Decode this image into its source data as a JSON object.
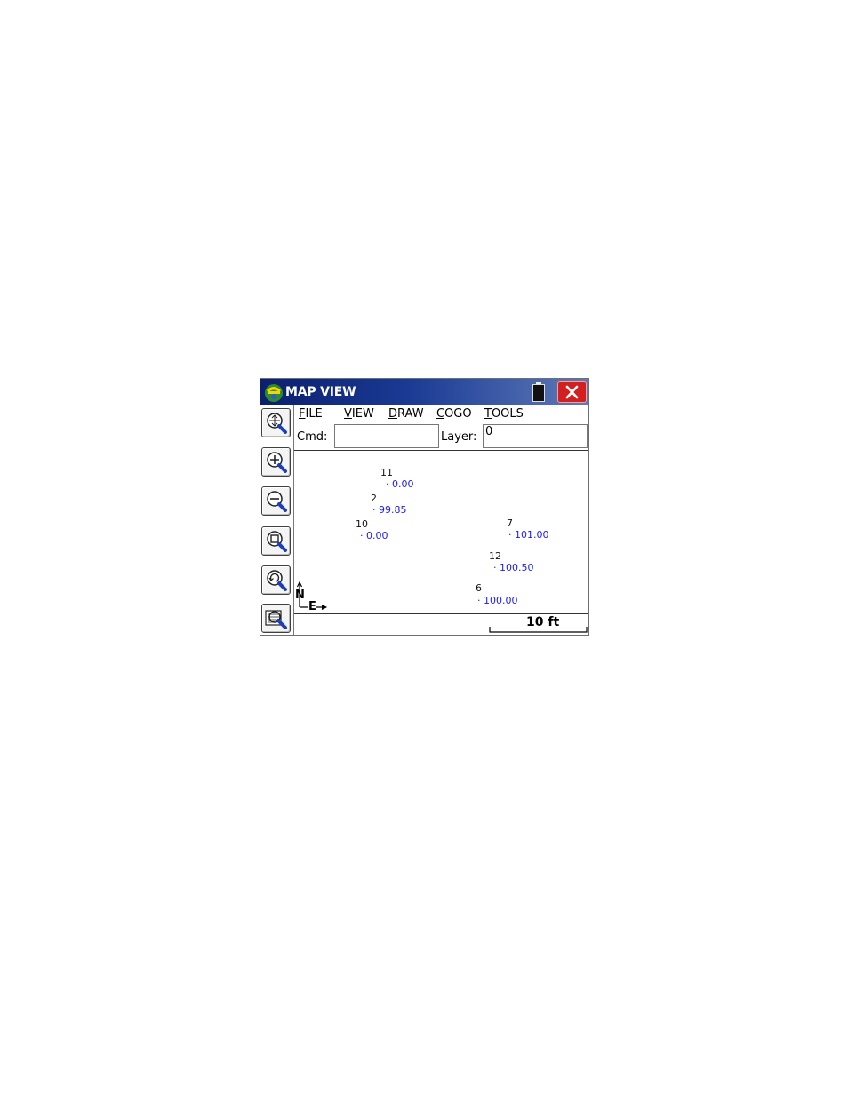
{
  "window": {
    "title": "MAP VIEW",
    "icons": {
      "logo": "app-logo-icon",
      "battery": "battery-icon",
      "close": "close-icon"
    },
    "colors": {
      "titlebar_start": "#0b1f6e",
      "titlebar_end": "#5f7ab8",
      "close_bg": "#d21f1f",
      "point_value": "#1a1aff"
    }
  },
  "menu": [
    {
      "accel": "F",
      "rest": "ILE"
    },
    {
      "accel": "V",
      "rest": "IEW"
    },
    {
      "accel": "D",
      "rest": "RAW"
    },
    {
      "accel": "C",
      "rest": "OGO"
    },
    {
      "accel": "T",
      "rest": "OOLS"
    }
  ],
  "command": {
    "label": "Cmd:",
    "value": ""
  },
  "layer": {
    "label": "Layer:",
    "value": "0"
  },
  "toolbar": [
    {
      "name": "zoom-extents-icon"
    },
    {
      "name": "zoom-in-icon"
    },
    {
      "name": "zoom-out-icon"
    },
    {
      "name": "zoom-window-icon"
    },
    {
      "name": "zoom-previous-icon"
    },
    {
      "name": "zoom-all-icon"
    }
  ],
  "map": {
    "points": [
      {
        "id": "11",
        "elevation": "0.00"
      },
      {
        "id": "2",
        "elevation": "99.85"
      },
      {
        "id": "10",
        "elevation": "0.00"
      },
      {
        "id": "7",
        "elevation": "101.00"
      },
      {
        "id": "12",
        "elevation": "100.50"
      },
      {
        "id": "6",
        "elevation": "100.00"
      }
    ],
    "north_label": "N",
    "east_label": "E",
    "scale_label": "10 ft"
  }
}
